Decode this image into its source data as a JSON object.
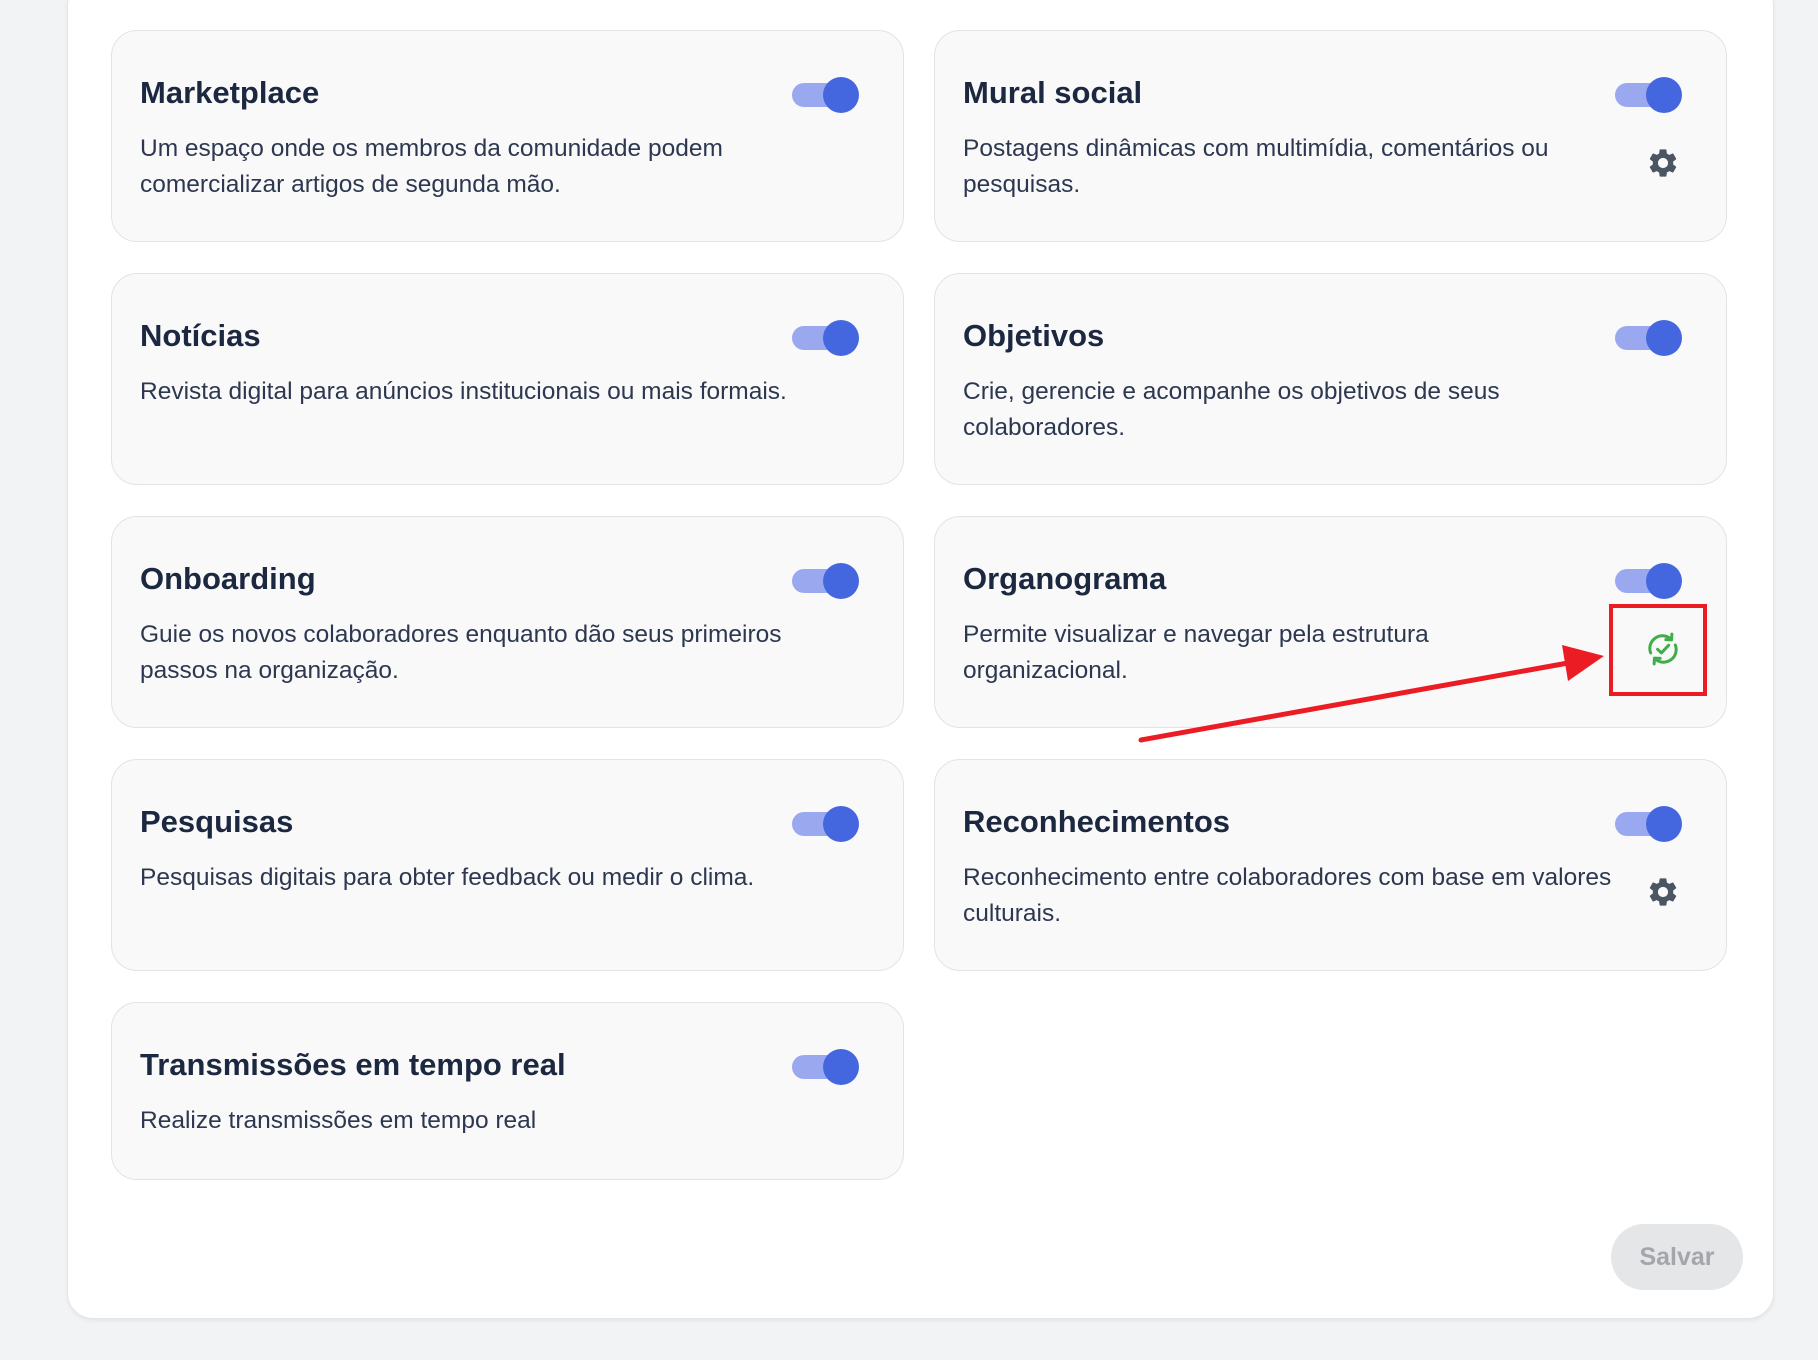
{
  "modules": [
    {
      "title": "Marketplace",
      "description": "Um espaço onde os membros da comunidade podem comercializar artigos de segunda mão.",
      "enabled": true
    },
    {
      "title": "Mural social",
      "description": "Postagens dinâmicas com multimídia, comentários ou pesquisas.",
      "enabled": true,
      "action_icon": "gear-icon"
    },
    {
      "title": "Notícias",
      "description": "Revista digital para anúncios institucionais ou mais formais.",
      "enabled": true
    },
    {
      "title": "Objetivos",
      "description": "Crie, gerencie e acompanhe os objetivos de seus colaboradores.",
      "enabled": true
    },
    {
      "title": "Onboarding",
      "description": "Guie os novos colaboradores enquanto dão seus primeiros passos na organização.",
      "enabled": true
    },
    {
      "title": "Organograma",
      "description": "Permite visualizar e navegar pela estrutura organizacional.",
      "enabled": true,
      "action_icon": "sync-check-icon"
    },
    {
      "title": "Pesquisas",
      "description": "Pesquisas digitais para obter feedback ou medir o clima.",
      "enabled": true
    },
    {
      "title": "Reconhecimentos",
      "description": "Reconhecimento entre colaboradores com base em valores culturais.",
      "enabled": true,
      "action_icon": "gear-icon"
    },
    {
      "title": "Transmissões em tempo real",
      "description": "Realize transmissões em tempo real",
      "enabled": true
    }
  ],
  "footer": {
    "save_label": "Salvar",
    "save_disabled": true
  },
  "colors": {
    "toggle_track": "#9aa8ef",
    "toggle_knob": "#4467e0",
    "sync_icon": "#3fae49",
    "gear_icon": "#4b5563",
    "annotation": "#ec1c24",
    "save_bg": "#e5e6e8",
    "save_text": "#a3a6ab"
  }
}
